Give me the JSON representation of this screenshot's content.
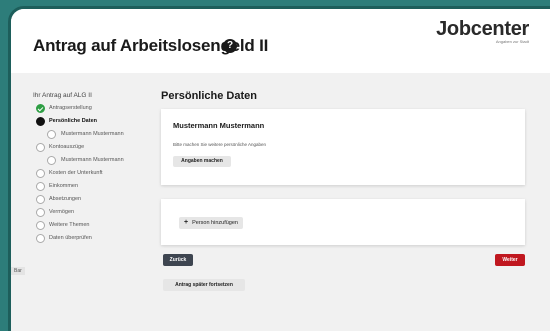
{
  "header": {
    "title": "Antrag auf Arbeitslosengeld II",
    "help_icon": "?",
    "logo_text": "Jobcenter",
    "logo_subtext": "Angaben zur Stadt"
  },
  "sidebar": {
    "heading": "Ihr Antrag auf ALG II",
    "steps": [
      {
        "label": "Antragserstellung",
        "state": "done"
      },
      {
        "label": "Persönliche Daten",
        "state": "active"
      },
      {
        "label": "Mustermann Mustermann",
        "state": "sub"
      },
      {
        "label": "Kontoauszüge",
        "state": "pending"
      },
      {
        "label": "Mustermann Mustermann",
        "state": "sub"
      },
      {
        "label": "Kosten der Unterkunft",
        "state": "pending"
      },
      {
        "label": "Einkommen",
        "state": "pending"
      },
      {
        "label": "Absetzungen",
        "state": "pending"
      },
      {
        "label": "Vermögen",
        "state": "pending"
      },
      {
        "label": "Weitere Themen",
        "state": "pending"
      },
      {
        "label": "Daten überprüfen",
        "state": "pending"
      }
    ],
    "side_tab": "Bar"
  },
  "main": {
    "title": "Persönliche Daten",
    "person_card": {
      "name": "Mustermann Mustermann",
      "instruction": "Bitte machen Sie weitere persönliche Angaben",
      "button": "Angaben machen"
    },
    "add_person": {
      "plus": "+",
      "label": "Person hinzufügen"
    },
    "back_button": "Zurück",
    "next_button": "Weiter",
    "later_button": "Antrag später fortsetzen"
  },
  "colors": {
    "frame": "#2d7d7a",
    "done": "#2e9e44",
    "next": "#c0171f",
    "back": "#3e4550"
  }
}
